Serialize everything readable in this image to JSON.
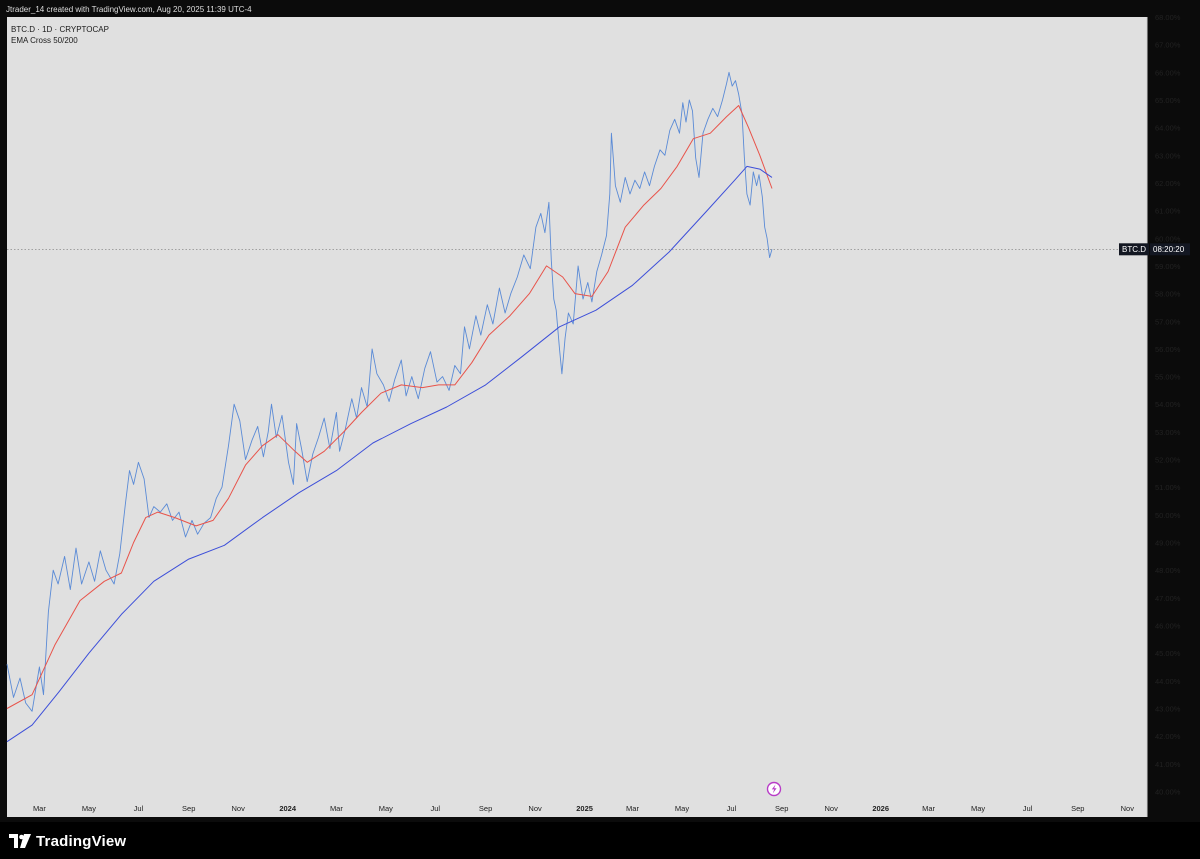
{
  "header": {
    "credit": "Jtrader_14 created with TradingView.com, Aug 20, 2025 11:39 UTC-4",
    "symbol_line": "BTC.D · 1D · CRYPTOCAP",
    "indicator_line": "EMA Cross 50/200"
  },
  "price_label": {
    "symbol": "BTC.D",
    "countdown": "08:20:20"
  },
  "footer": {
    "brand": "TradingView"
  },
  "colors": {
    "price": "#5b8bd6",
    "ema_fast": "#e8534a",
    "ema_slow": "#3d4fd9",
    "panel": "#e0e0e0",
    "alert": "#b83cc7"
  },
  "chart_data": {
    "type": "line",
    "title": "",
    "xlabel": "",
    "ylabel": "",
    "ylim": [
      39.8,
      68.0
    ],
    "x_tick_labels": [
      "Mar",
      "May",
      "Jul",
      "Sep",
      "Nov",
      "2024",
      "Mar",
      "May",
      "Jul",
      "Sep",
      "Nov",
      "2025",
      "Mar",
      "May",
      "Jul",
      "Sep",
      "Nov",
      "2026",
      "Mar",
      "May",
      "Jul",
      "Sep",
      "Nov"
    ],
    "x_tick_bold": [
      "2024",
      "2025",
      "2026"
    ],
    "y_tick_labels": [
      "68.00%",
      "67.00%",
      "66.00%",
      "65.00%",
      "64.00%",
      "63.00%",
      "62.00%",
      "61.00%",
      "60.00%",
      "59.00%",
      "58.00%",
      "57.00%",
      "56.00%",
      "55.00%",
      "54.00%",
      "53.00%",
      "52.00%",
      "51.00%",
      "50.00%",
      "49.00%",
      "48.00%",
      "47.00%",
      "46.00%",
      "45.00%",
      "44.00%",
      "43.00%",
      "42.00%",
      "41.00%",
      "40.00%"
    ],
    "y_tick_values": [
      68,
      67,
      66,
      65,
      64,
      63,
      62,
      61,
      60,
      59,
      58,
      57,
      56,
      55,
      54,
      53,
      52,
      51,
      50,
      49,
      48,
      47,
      46,
      45,
      44,
      43,
      42,
      41,
      40
    ],
    "current_value": 59.6,
    "grid": false,
    "legend": "none",
    "series": [
      {
        "name": "BTC.D",
        "values": [
          [
            "2023-01-20",
            44.6
          ],
          [
            "2023-01-28",
            43.4
          ],
          [
            "2023-02-05",
            44.1
          ],
          [
            "2023-02-12",
            43.2
          ],
          [
            "2023-02-20",
            42.9
          ],
          [
            "2023-03-01",
            44.5
          ],
          [
            "2023-03-06",
            43.5
          ],
          [
            "2023-03-12",
            46.5
          ],
          [
            "2023-03-18",
            48.0
          ],
          [
            "2023-03-24",
            47.5
          ],
          [
            "2023-04-01",
            48.5
          ],
          [
            "2023-04-08",
            47.3
          ],
          [
            "2023-04-15",
            48.8
          ],
          [
            "2023-04-22",
            47.5
          ],
          [
            "2023-05-01",
            48.3
          ],
          [
            "2023-05-08",
            47.6
          ],
          [
            "2023-05-15",
            48.7
          ],
          [
            "2023-05-22",
            48.0
          ],
          [
            "2023-06-01",
            47.5
          ],
          [
            "2023-06-08",
            48.6
          ],
          [
            "2023-06-15",
            50.4
          ],
          [
            "2023-06-20",
            51.6
          ],
          [
            "2023-06-25",
            51.1
          ],
          [
            "2023-07-01",
            51.9
          ],
          [
            "2023-07-08",
            51.3
          ],
          [
            "2023-07-14",
            49.9
          ],
          [
            "2023-07-20",
            50.3
          ],
          [
            "2023-07-28",
            50.1
          ],
          [
            "2023-08-05",
            50.4
          ],
          [
            "2023-08-12",
            49.8
          ],
          [
            "2023-08-20",
            50.1
          ],
          [
            "2023-08-28",
            49.2
          ],
          [
            "2023-09-05",
            49.8
          ],
          [
            "2023-09-12",
            49.3
          ],
          [
            "2023-09-20",
            49.7
          ],
          [
            "2023-09-28",
            49.9
          ],
          [
            "2023-10-05",
            50.6
          ],
          [
            "2023-10-12",
            51.0
          ],
          [
            "2023-10-20",
            52.5
          ],
          [
            "2023-10-27",
            54.0
          ],
          [
            "2023-11-03",
            53.4
          ],
          [
            "2023-11-10",
            52.0
          ],
          [
            "2023-11-18",
            52.7
          ],
          [
            "2023-11-25",
            53.2
          ],
          [
            "2023-12-02",
            52.1
          ],
          [
            "2023-12-08",
            53.0
          ],
          [
            "2023-12-12",
            54.0
          ],
          [
            "2023-12-18",
            52.8
          ],
          [
            "2023-12-25",
            53.6
          ],
          [
            "2024-01-02",
            51.9
          ],
          [
            "2024-01-08",
            51.1
          ],
          [
            "2024-01-12",
            53.3
          ],
          [
            "2024-01-18",
            52.4
          ],
          [
            "2024-01-25",
            51.2
          ],
          [
            "2024-02-01",
            52.2
          ],
          [
            "2024-02-08",
            52.8
          ],
          [
            "2024-02-15",
            53.5
          ],
          [
            "2024-02-22",
            52.4
          ],
          [
            "2024-03-01",
            53.7
          ],
          [
            "2024-03-05",
            52.3
          ],
          [
            "2024-03-12",
            53.1
          ],
          [
            "2024-03-20",
            54.2
          ],
          [
            "2024-03-26",
            53.5
          ],
          [
            "2024-04-01",
            54.6
          ],
          [
            "2024-04-08",
            53.9
          ],
          [
            "2024-04-14",
            56.0
          ],
          [
            "2024-04-20",
            55.1
          ],
          [
            "2024-04-28",
            54.7
          ],
          [
            "2024-05-05",
            54.1
          ],
          [
            "2024-05-12",
            54.9
          ],
          [
            "2024-05-20",
            55.6
          ],
          [
            "2024-05-26",
            54.3
          ],
          [
            "2024-06-02",
            55.0
          ],
          [
            "2024-06-10",
            54.2
          ],
          [
            "2024-06-18",
            55.3
          ],
          [
            "2024-06-25",
            55.9
          ],
          [
            "2024-07-03",
            54.8
          ],
          [
            "2024-07-10",
            55.0
          ],
          [
            "2024-07-18",
            54.5
          ],
          [
            "2024-07-25",
            55.4
          ],
          [
            "2024-08-01",
            55.1
          ],
          [
            "2024-08-06",
            56.8
          ],
          [
            "2024-08-12",
            56.0
          ],
          [
            "2024-08-20",
            57.2
          ],
          [
            "2024-08-26",
            56.5
          ],
          [
            "2024-09-03",
            57.6
          ],
          [
            "2024-09-10",
            56.9
          ],
          [
            "2024-09-18",
            58.2
          ],
          [
            "2024-09-25",
            57.3
          ],
          [
            "2024-10-02",
            58.0
          ],
          [
            "2024-10-10",
            58.6
          ],
          [
            "2024-10-18",
            59.4
          ],
          [
            "2024-10-26",
            58.9
          ],
          [
            "2024-11-02",
            60.4
          ],
          [
            "2024-11-08",
            60.9
          ],
          [
            "2024-11-13",
            60.2
          ],
          [
            "2024-11-18",
            61.3
          ],
          [
            "2024-11-21",
            59.2
          ],
          [
            "2024-11-24",
            57.8
          ],
          [
            "2024-11-27",
            57.4
          ],
          [
            "2024-12-01",
            56.0
          ],
          [
            "2024-12-04",
            55.1
          ],
          [
            "2024-12-08",
            56.4
          ],
          [
            "2024-12-12",
            57.3
          ],
          [
            "2024-12-18",
            56.9
          ],
          [
            "2024-12-24",
            59.0
          ],
          [
            "2024-12-30",
            57.8
          ],
          [
            "2025-01-05",
            58.4
          ],
          [
            "2025-01-10",
            57.7
          ],
          [
            "2025-01-16",
            58.8
          ],
          [
            "2025-01-22",
            59.4
          ],
          [
            "2025-01-28",
            60.1
          ],
          [
            "2025-02-01",
            61.6
          ],
          [
            "2025-02-03",
            63.8
          ],
          [
            "2025-02-08",
            61.9
          ],
          [
            "2025-02-14",
            61.3
          ],
          [
            "2025-02-20",
            62.2
          ],
          [
            "2025-02-26",
            61.6
          ],
          [
            "2025-03-04",
            62.1
          ],
          [
            "2025-03-10",
            61.8
          ],
          [
            "2025-03-16",
            62.4
          ],
          [
            "2025-03-22",
            61.9
          ],
          [
            "2025-03-28",
            62.6
          ],
          [
            "2025-04-04",
            63.2
          ],
          [
            "2025-04-10",
            63.0
          ],
          [
            "2025-04-16",
            63.9
          ],
          [
            "2025-04-22",
            64.3
          ],
          [
            "2025-04-28",
            63.8
          ],
          [
            "2025-05-02",
            64.9
          ],
          [
            "2025-05-06",
            64.2
          ],
          [
            "2025-05-10",
            65.0
          ],
          [
            "2025-05-14",
            64.6
          ],
          [
            "2025-05-18",
            62.9
          ],
          [
            "2025-05-22",
            62.2
          ],
          [
            "2025-05-27",
            63.8
          ],
          [
            "2025-06-02",
            64.3
          ],
          [
            "2025-06-08",
            64.7
          ],
          [
            "2025-06-14",
            64.4
          ],
          [
            "2025-06-20",
            65.0
          ],
          [
            "2025-06-25",
            65.6
          ],
          [
            "2025-06-28",
            66.0
          ],
          [
            "2025-07-02",
            65.5
          ],
          [
            "2025-07-06",
            65.7
          ],
          [
            "2025-07-10",
            65.2
          ],
          [
            "2025-07-14",
            64.5
          ],
          [
            "2025-07-17",
            62.9
          ],
          [
            "2025-07-20",
            61.6
          ],
          [
            "2025-07-24",
            61.2
          ],
          [
            "2025-07-28",
            62.4
          ],
          [
            "2025-08-01",
            61.9
          ],
          [
            "2025-08-04",
            62.3
          ],
          [
            "2025-08-08",
            61.5
          ],
          [
            "2025-08-11",
            60.4
          ],
          [
            "2025-08-14",
            60.0
          ],
          [
            "2025-08-17",
            59.3
          ],
          [
            "2025-08-20",
            59.6
          ]
        ]
      },
      {
        "name": "EMA 50",
        "values": [
          [
            "2023-01-20",
            43.0
          ],
          [
            "2023-02-20",
            43.5
          ],
          [
            "2023-03-20",
            45.3
          ],
          [
            "2023-04-20",
            46.9
          ],
          [
            "2023-05-20",
            47.6
          ],
          [
            "2023-06-10",
            47.9
          ],
          [
            "2023-06-25",
            49.0
          ],
          [
            "2023-07-10",
            49.9
          ],
          [
            "2023-07-25",
            50.1
          ],
          [
            "2023-08-15",
            49.9
          ],
          [
            "2023-09-10",
            49.6
          ],
          [
            "2023-10-01",
            49.8
          ],
          [
            "2023-10-20",
            50.6
          ],
          [
            "2023-11-10",
            51.8
          ],
          [
            "2023-12-01",
            52.5
          ],
          [
            "2023-12-20",
            52.9
          ],
          [
            "2024-01-10",
            52.3
          ],
          [
            "2024-01-25",
            51.9
          ],
          [
            "2024-02-15",
            52.3
          ],
          [
            "2024-03-10",
            53.0
          ],
          [
            "2024-04-01",
            53.7
          ],
          [
            "2024-04-25",
            54.4
          ],
          [
            "2024-05-20",
            54.7
          ],
          [
            "2024-06-15",
            54.6
          ],
          [
            "2024-07-05",
            54.7
          ],
          [
            "2024-07-25",
            54.7
          ],
          [
            "2024-08-15",
            55.5
          ],
          [
            "2024-09-05",
            56.5
          ],
          [
            "2024-10-01",
            57.2
          ],
          [
            "2024-10-25",
            58.0
          ],
          [
            "2024-11-15",
            59.0
          ],
          [
            "2024-12-05",
            58.6
          ],
          [
            "2024-12-20",
            58.0
          ],
          [
            "2025-01-10",
            57.9
          ],
          [
            "2025-01-30",
            58.8
          ],
          [
            "2025-02-20",
            60.4
          ],
          [
            "2025-03-15",
            61.2
          ],
          [
            "2025-04-05",
            61.8
          ],
          [
            "2025-04-25",
            62.6
          ],
          [
            "2025-05-15",
            63.6
          ],
          [
            "2025-06-05",
            63.8
          ],
          [
            "2025-06-25",
            64.4
          ],
          [
            "2025-07-10",
            64.8
          ],
          [
            "2025-07-22",
            64.0
          ],
          [
            "2025-08-05",
            63.0
          ],
          [
            "2025-08-20",
            61.8
          ]
        ]
      },
      {
        "name": "EMA 200",
        "values": [
          [
            "2023-01-20",
            41.8
          ],
          [
            "2023-02-20",
            42.4
          ],
          [
            "2023-03-25",
            43.6
          ],
          [
            "2023-05-01",
            45.0
          ],
          [
            "2023-06-10",
            46.4
          ],
          [
            "2023-07-20",
            47.6
          ],
          [
            "2023-09-01",
            48.4
          ],
          [
            "2023-10-15",
            48.9
          ],
          [
            "2023-12-01",
            49.9
          ],
          [
            "2024-01-15",
            50.8
          ],
          [
            "2024-03-01",
            51.6
          ],
          [
            "2024-04-15",
            52.6
          ],
          [
            "2024-06-01",
            53.3
          ],
          [
            "2024-07-15",
            53.9
          ],
          [
            "2024-09-01",
            54.7
          ],
          [
            "2024-10-15",
            55.7
          ],
          [
            "2024-12-01",
            56.8
          ],
          [
            "2025-01-15",
            57.4
          ],
          [
            "2025-03-01",
            58.3
          ],
          [
            "2025-04-15",
            59.5
          ],
          [
            "2025-06-01",
            61.0
          ],
          [
            "2025-07-05",
            62.1
          ],
          [
            "2025-07-20",
            62.6
          ],
          [
            "2025-08-05",
            62.5
          ],
          [
            "2025-08-20",
            62.2
          ]
        ]
      }
    ]
  }
}
